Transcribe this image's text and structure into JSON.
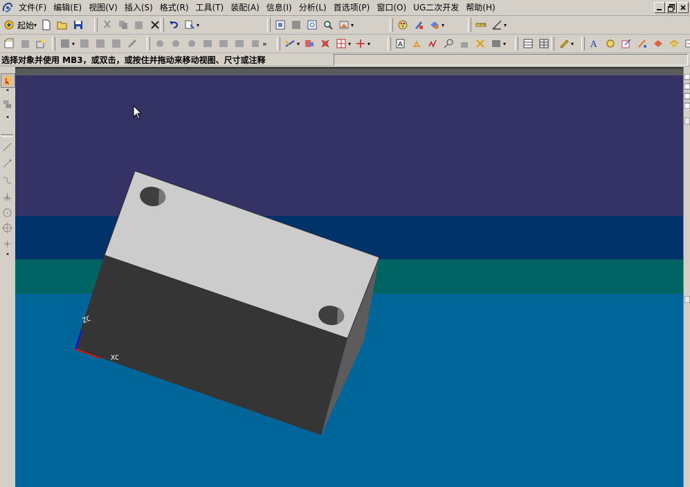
{
  "menu": {
    "items": [
      {
        "label": "文件(F)",
        "name": "menu-file"
      },
      {
        "label": "编辑(E)",
        "name": "menu-edit"
      },
      {
        "label": "视图(V)",
        "name": "menu-view"
      },
      {
        "label": "插入(S)",
        "name": "menu-insert"
      },
      {
        "label": "格式(R)",
        "name": "menu-format"
      },
      {
        "label": "工具(T)",
        "name": "menu-tools"
      },
      {
        "label": "装配(A)",
        "name": "menu-assemblies"
      },
      {
        "label": "信息(I)",
        "name": "menu-information"
      },
      {
        "label": "分析(L)",
        "name": "menu-analysis"
      },
      {
        "label": "首选项(P)",
        "name": "menu-preferences"
      },
      {
        "label": "窗口(O)",
        "name": "menu-window"
      },
      {
        "label": "UG二次开发",
        "name": "menu-ug-dev"
      },
      {
        "label": "帮助(H)",
        "name": "menu-help"
      }
    ]
  },
  "toolbar": {
    "start_label": "起始"
  },
  "prompt": {
    "text": "选择对象并使用 MB3，或双击，或按住并拖动来移动视图、尺寸或注释"
  },
  "viewport": {
    "axis_x_label": "XC",
    "axis_z_label": "ZC",
    "colors": {
      "bg_top": "#353266",
      "bg_band1": "#00336a",
      "bg_band2": "#006464",
      "bg_bottom": "#00669a",
      "block_top": "#cccccc",
      "block_front": "#353535",
      "block_side": "#5c5c5c"
    }
  }
}
